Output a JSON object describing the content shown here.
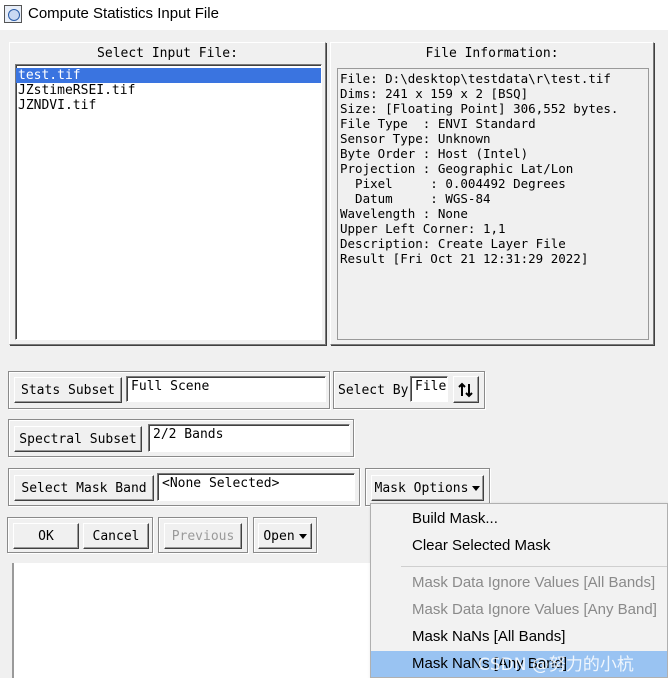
{
  "window": {
    "title": "Compute Statistics Input File"
  },
  "select_input": {
    "title": "Select Input File:",
    "files": [
      "test.tif",
      "JZstimeRSEI.tif",
      "JZNDVI.tif"
    ],
    "selected_index": 0
  },
  "file_info": {
    "title": "File Information:",
    "lines": [
      "File: D:\\desktop\\testdata\\r\\test.tif",
      "Dims: 241 x 159 x 2 [BSQ]",
      "Size: [Floating Point] 306,552 bytes.",
      "File Type  : ENVI Standard",
      "Sensor Type: Unknown",
      "Byte Order : Host (Intel)",
      "Projection : Geographic Lat/Lon",
      "  Pixel     : 0.004492 Degrees",
      "  Datum     : WGS-84",
      "Wavelength : None",
      "Upper Left Corner: 1,1",
      "Description: Create Layer File",
      "Result [Fri Oct 21 12:31:29 2022]"
    ]
  },
  "stats_subset": {
    "button": "Stats Subset",
    "value": "Full Scene"
  },
  "select_by": {
    "label": "Select By",
    "value": "File",
    "sort_icon": "sort-up-down-icon"
  },
  "spectral_subset": {
    "button": "Spectral Subset",
    "value": "2/2 Bands"
  },
  "mask_band": {
    "button": "Select Mask Band",
    "value": "<None Selected>"
  },
  "mask_options": {
    "button": "Mask Options"
  },
  "bottom_buttons": {
    "ok": "OK",
    "cancel": "Cancel",
    "previous": "Previous",
    "open": "Open"
  },
  "mask_menu": {
    "items": [
      {
        "label": "Build Mask...",
        "enabled": true
      },
      {
        "label": "Clear Selected Mask",
        "enabled": true
      },
      {
        "label": "Mask Data Ignore Values [All Bands]",
        "enabled": false
      },
      {
        "label": "Mask Data Ignore Values [Any Band]",
        "enabled": false
      },
      {
        "label": "Mask NaNs [All Bands]",
        "enabled": true
      },
      {
        "label": "Mask NaNs [Any Band]",
        "enabled": true,
        "highlighted": true
      }
    ]
  },
  "watermark": "CSDN @努力的小杭",
  "colors": {
    "selection": "#3a74e0",
    "menu_highlight": "#99c3f2"
  }
}
